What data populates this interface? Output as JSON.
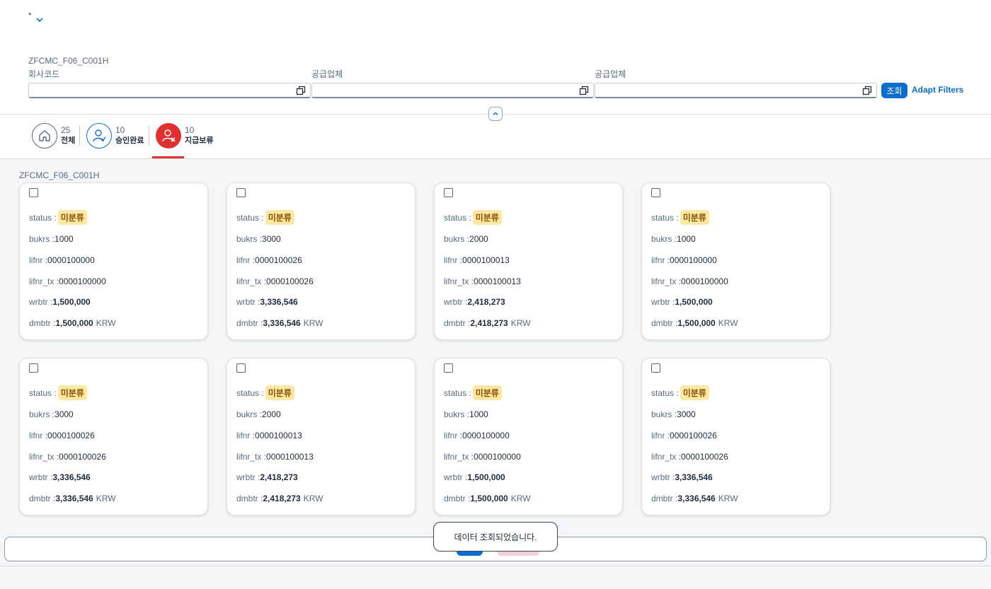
{
  "header": {
    "variant_name": "*",
    "filter_title": "ZFCMC_F06_C001H",
    "fields": [
      {
        "label": "회사코드",
        "value": ""
      },
      {
        "label": "공급업체",
        "value": ""
      },
      {
        "label": "공급업체",
        "value": ""
      }
    ],
    "go_label": "조회",
    "adapt_filters_label": "Adapt Filters"
  },
  "tabs": [
    {
      "count": "25",
      "label": "전체",
      "icon": "home-icon"
    },
    {
      "count": "10",
      "label": "승인완료",
      "icon": "user-check-icon"
    },
    {
      "count": "10",
      "label": "지급보류",
      "icon": "user-reject-icon",
      "selected": true
    }
  ],
  "content": {
    "title": "ZFCMC_F06_C001H",
    "field_labels": {
      "status": "status :",
      "bukrs": "bukrs :",
      "lifnr": "lifnr :",
      "lifnr_tx": "lifnr_tx :",
      "wrbtr": "wrbtr :",
      "dmbtr": "dmbtr :"
    },
    "cards": [
      {
        "status": "미분류",
        "bukrs": "1000",
        "lifnr": "0000100000",
        "lifnr_tx": "0000100000",
        "wrbtr": "1,500,000",
        "dmbtr": "1,500,000",
        "currency": "KRW"
      },
      {
        "status": "미분류",
        "bukrs": "3000",
        "lifnr": "0000100026",
        "lifnr_tx": "0000100026",
        "wrbtr": "3,336,546",
        "dmbtr": "3,336,546",
        "currency": "KRW"
      },
      {
        "status": "미분류",
        "bukrs": "2000",
        "lifnr": "0000100013",
        "lifnr_tx": "0000100013",
        "wrbtr": "2,418,273",
        "dmbtr": "2,418,273",
        "currency": "KRW"
      },
      {
        "status": "미분류",
        "bukrs": "1000",
        "lifnr": "0000100000",
        "lifnr_tx": "0000100000",
        "wrbtr": "1,500,000",
        "dmbtr": "1,500,000",
        "currency": "KRW"
      },
      {
        "status": "미분류",
        "bukrs": "3000",
        "lifnr": "0000100026",
        "lifnr_tx": "0000100026",
        "wrbtr": "3,336,546",
        "dmbtr": "3,336,546",
        "currency": "KRW"
      },
      {
        "status": "미분류",
        "bukrs": "2000",
        "lifnr": "0000100013",
        "lifnr_tx": "0000100013",
        "wrbtr": "2,418,273",
        "dmbtr": "2,418,273",
        "currency": "KRW"
      },
      {
        "status": "미분류",
        "bukrs": "1000",
        "lifnr": "0000100000",
        "lifnr_tx": "0000100000",
        "wrbtr": "1,500,000",
        "dmbtr": "1,500,000",
        "currency": "KRW"
      },
      {
        "status": "미분류",
        "bukrs": "3000",
        "lifnr": "0000100026",
        "lifnr_tx": "0000100026",
        "wrbtr": "3,336,546",
        "dmbtr": "3,336,546",
        "currency": "KRW"
      }
    ]
  },
  "toast": {
    "message": "데이터 조회되었습니다."
  },
  "colors": {
    "accent": "#0a6ed1",
    "reject": "#e0302f",
    "badge_bg": "#ffe8a3",
    "badge_text": "#8a4f00"
  }
}
